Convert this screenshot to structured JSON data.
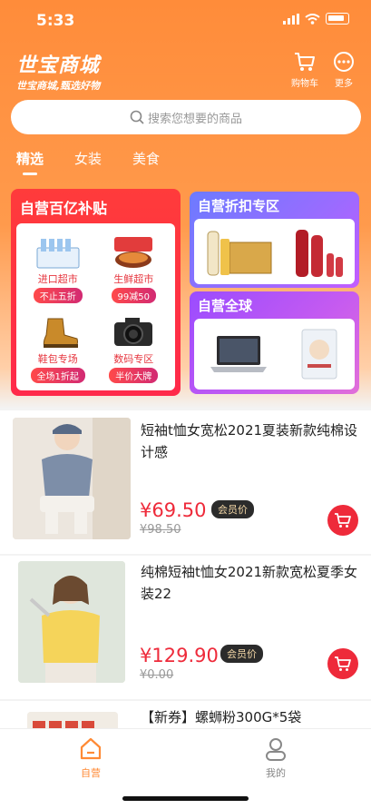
{
  "status_bar": {
    "time": "5:33"
  },
  "header": {
    "brand_title": "世宝商城",
    "brand_subtitle": "世宝商城,甄选好物",
    "cart_label": "购物车",
    "more_label": "更多"
  },
  "search": {
    "placeholder": "搜索您想要的商品"
  },
  "tabs": [
    {
      "label": "精选",
      "active": true
    },
    {
      "label": "女装",
      "active": false
    },
    {
      "label": "美食",
      "active": false
    }
  ],
  "promo": {
    "subsidy": {
      "title": "自营百亿补贴",
      "cells": [
        {
          "label": "进口超市",
          "badge": "不止五折"
        },
        {
          "label": "生鲜超市",
          "badge": "99减50"
        },
        {
          "label": "鞋包专场",
          "badge": "全场1折起"
        },
        {
          "label": "数码专区",
          "badge": "半价大牌"
        }
      ]
    },
    "discount": {
      "title": "自营折扣专区"
    },
    "global": {
      "title": "自营全球"
    }
  },
  "products": [
    {
      "title": "短袖t恤女宽松2021夏装新款纯棉设计感",
      "price": "¥69.50",
      "member_label": "会员价",
      "original_price": "¥98.50"
    },
    {
      "title": "纯棉短袖t恤女2021新款宽松夏季女装22",
      "price": "¥129.90",
      "member_label": "会员价",
      "original_price": "¥0.00"
    },
    {
      "title": "【新券】螺蛳粉300G*5袋"
    }
  ],
  "bottom_nav": {
    "home_label": "自营",
    "mine_label": "我的"
  },
  "colors": {
    "accent": "#ff8a35",
    "price_red": "#ee2a3a",
    "promo_red": "#ff3b3b",
    "promo_purple": "#9b6bff"
  }
}
